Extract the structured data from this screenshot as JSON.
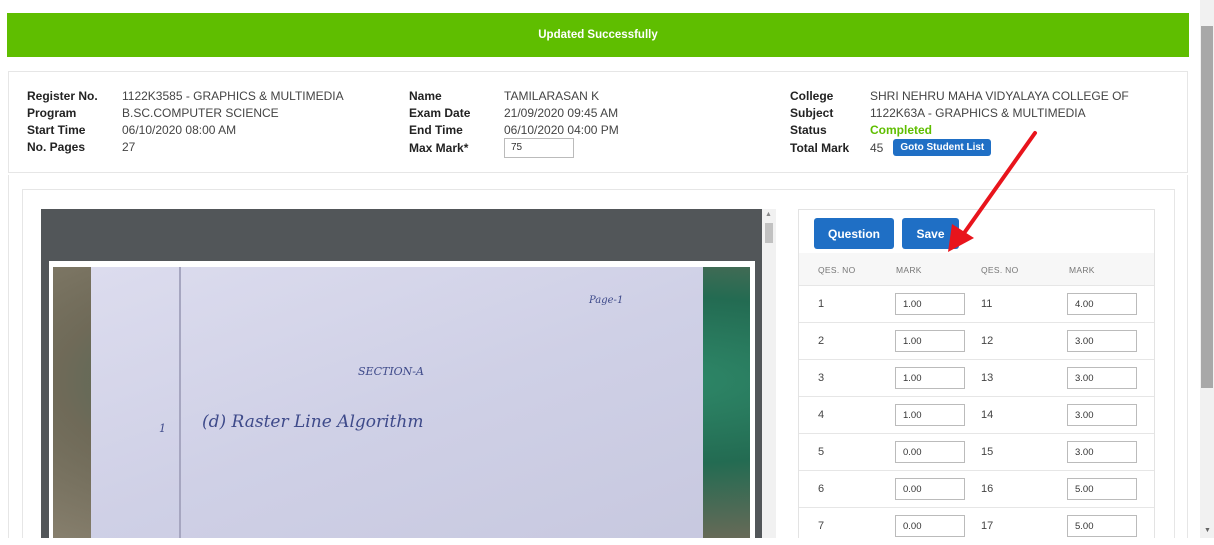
{
  "alert": {
    "message": "Updated Successfully",
    "color": "#5fbe00"
  },
  "info": {
    "col1": [
      {
        "label": "Register No.",
        "value": "1122K3585 - GRAPHICS & MULTIMEDIA"
      },
      {
        "label": "Program",
        "value": "B.SC.COMPUTER SCIENCE"
      },
      {
        "label": "Start Time",
        "value": "06/10/2020 08:00 AM"
      },
      {
        "label": "No. Pages",
        "value": "27"
      }
    ],
    "col2": [
      {
        "label": "Name",
        "value": "TAMILARASAN K"
      },
      {
        "label": "Exam Date",
        "value": "21/09/2020 09:45 AM"
      },
      {
        "label": "End Time",
        "value": "06/10/2020 04:00 PM"
      },
      {
        "label": "Max Mark*",
        "value": "75"
      }
    ],
    "col3": [
      {
        "label": "College",
        "value": "SHRI NEHRU MAHA VIDYALAYA COLLEGE OF"
      },
      {
        "label": "Subject",
        "value": "1122K63A - GRAPHICS & MULTIMEDIA"
      },
      {
        "label": "Status",
        "value": "Completed"
      },
      {
        "label": "Total Mark",
        "value": "45"
      }
    ],
    "goto_label": "Goto Student List"
  },
  "scan": {
    "page_label": "Page-1",
    "section": "SECTION-A",
    "answer_no": "1",
    "answer_text": "(d)  Raster  Line  Algorithm"
  },
  "marks": {
    "question_label": "Question",
    "save_label": "Save",
    "headers": [
      "QES. NO",
      "MARK",
      "QES. NO",
      "MARK"
    ],
    "rows": [
      {
        "q1": "1",
        "m1": "1.00",
        "q2": "11",
        "m2": "4.00"
      },
      {
        "q1": "2",
        "m1": "1.00",
        "q2": "12",
        "m2": "3.00"
      },
      {
        "q1": "3",
        "m1": "1.00",
        "q2": "13",
        "m2": "3.00"
      },
      {
        "q1": "4",
        "m1": "1.00",
        "q2": "14",
        "m2": "3.00"
      },
      {
        "q1": "5",
        "m1": "0.00",
        "q2": "15",
        "m2": "3.00"
      },
      {
        "q1": "6",
        "m1": "0.00",
        "q2": "16",
        "m2": "5.00"
      },
      {
        "q1": "7",
        "m1": "0.00",
        "q2": "17",
        "m2": "5.00"
      }
    ]
  },
  "colors": {
    "accent_blue": "#1f6fc5",
    "success_green": "#5fbe00",
    "annotation_red": "#e8141c"
  },
  "icons": [
    "red-arrow-annotation-icon",
    "scroll-up-arrow-icon",
    "scroll-down-arrow-icon"
  ]
}
